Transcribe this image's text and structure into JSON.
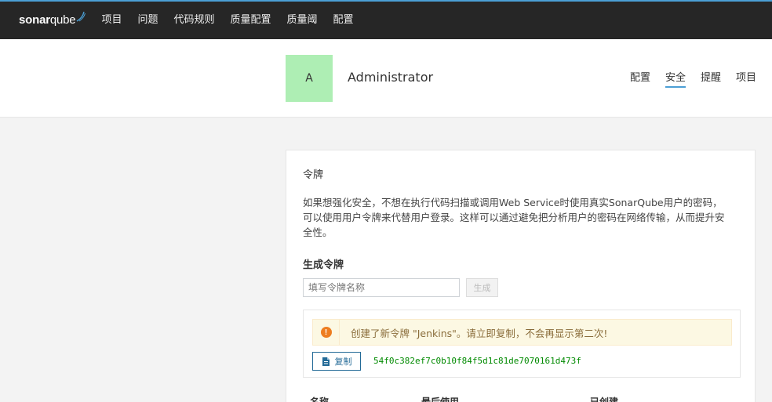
{
  "topbar": {
    "logo_bold": "sonar",
    "logo_light": "qube",
    "nav_items": [
      "项目",
      "问题",
      "代码规则",
      "质量配置",
      "质量阈",
      "配置"
    ]
  },
  "account": {
    "avatar_letter": "A",
    "user_name": "Administrator",
    "nav": [
      "配置",
      "安全",
      "提醒",
      "项目"
    ],
    "active_nav": "安全"
  },
  "tokens": {
    "title": "令牌",
    "description": "如果想强化安全，不想在执行代码扫描或调用Web Service时使用真实SonarQube用户的密码，可以使用用户令牌来代替用户登录。这样可以通过避免把分析用户的密码在网络传输，从而提升安全性。",
    "generate_title": "生成令牌",
    "input_placeholder": "填写令牌名称",
    "generate_button": "生成",
    "alert_text": "创建了新令牌 \"Jenkins\"。请立即复制，不会再显示第二次!",
    "copy_button": "复制",
    "token_value": "54f0c382ef7c0b10f84f5d1c81de7070161d473f",
    "table_headers": [
      "名称",
      "最后使用",
      "已创建"
    ]
  },
  "colors": {
    "topbar_bg": "#262626",
    "accent": "#4b9fd5",
    "avatar_bg": "#aeeeb4",
    "alert_bg": "#fcf8e3",
    "warning_icon": "#ed7d20",
    "token_text": "#008a00",
    "copy_button": "#236a97"
  }
}
